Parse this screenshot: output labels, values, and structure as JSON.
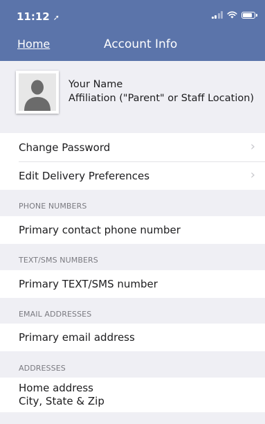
{
  "status_bar": {
    "time": "11:12",
    "location_glyph": "➚",
    "battery_level": 0.8
  },
  "nav": {
    "back_label": "Home",
    "title": "Account Info"
  },
  "profile": {
    "name": "Your Name",
    "affiliation": "Affiliation (\"Parent\" or Staff Location)"
  },
  "menu": {
    "change_password": "Change Password",
    "edit_delivery": "Edit Delivery Preferences",
    "chevron": "›"
  },
  "sections": {
    "phone_header": "PHONE NUMBERS",
    "phone_value": "Primary contact phone number",
    "sms_header": "TEXT/SMS NUMBERS",
    "sms_value": "Primary TEXT/SMS number",
    "email_header": "EMAIL ADDRESSES",
    "email_value": "Primary email address",
    "address_header": "ADDRESSES",
    "address_line1": "Home address",
    "address_line2": "City, State & Zip"
  },
  "colors": {
    "nav_bar": "#5b74aa",
    "background": "#efeff4",
    "row": "#ffffff"
  }
}
